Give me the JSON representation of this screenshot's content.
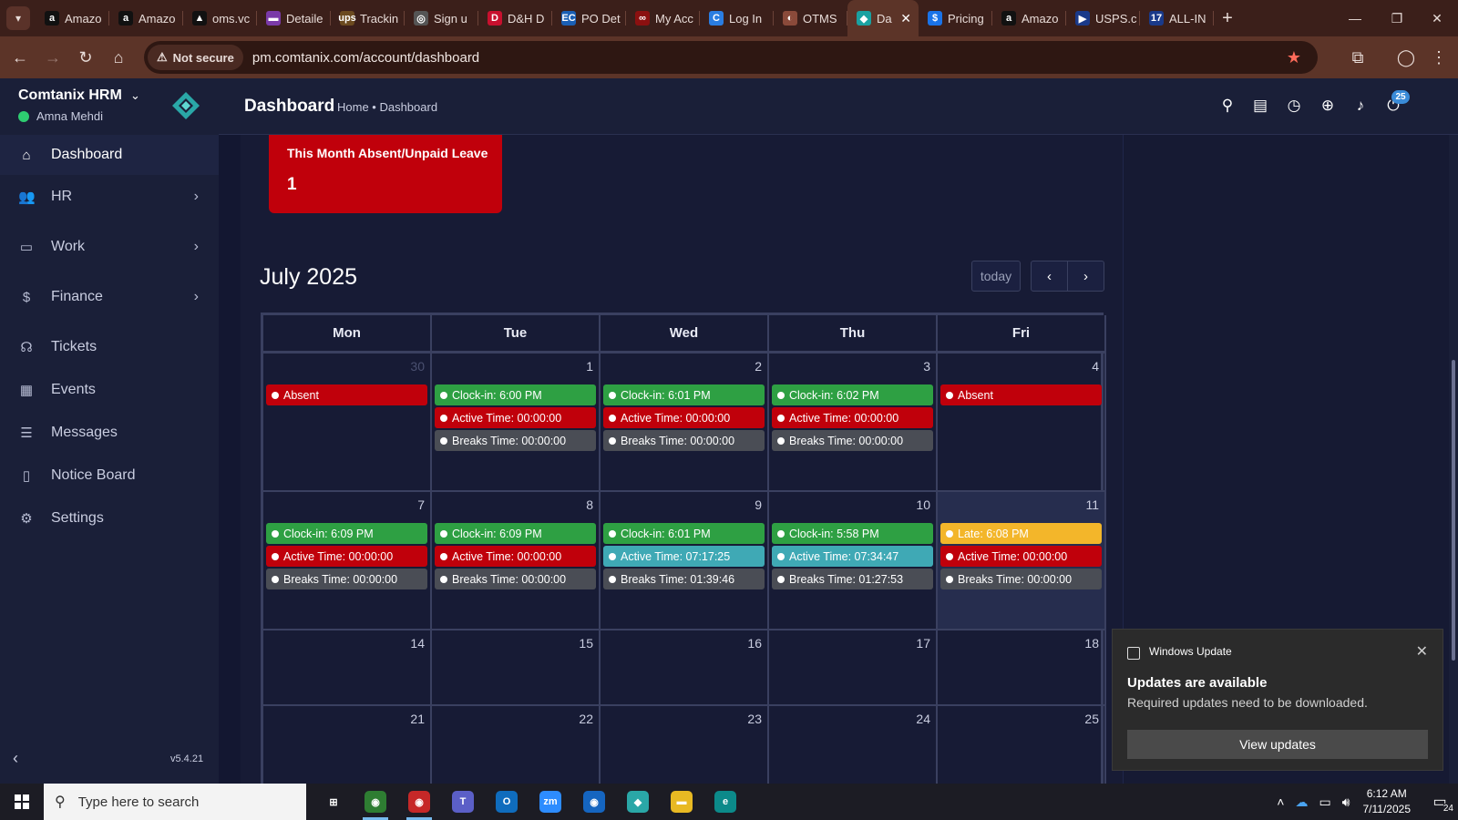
{
  "browser": {
    "tabs": [
      {
        "label": "Amazo",
        "fav": "a",
        "favColor": "#111111"
      },
      {
        "label": "Amazo",
        "fav": "a",
        "favColor": "#111111"
      },
      {
        "label": "oms.vc",
        "fav": "▲",
        "favColor": "#111111"
      },
      {
        "label": "Detaile",
        "fav": "▬",
        "favColor": "#7a3aa8"
      },
      {
        "label": "Trackin",
        "fav": "ups",
        "favColor": "#6b4a1f"
      },
      {
        "label": "Sign u",
        "fav": "◎",
        "favColor": "#555555"
      },
      {
        "label": "D&H D",
        "fav": "D",
        "favColor": "#c8102e"
      },
      {
        "label": "PO Det",
        "fav": "EC",
        "favColor": "#1a5fb4"
      },
      {
        "label": "My Acc",
        "fav": "∞",
        "favColor": "#8b1010"
      },
      {
        "label": "Log In",
        "fav": "C",
        "favColor": "#2a7de1"
      },
      {
        "label": "OTMS",
        "fav": "◐",
        "favColor": "#8a4a3a"
      },
      {
        "label": "Da",
        "fav": "◆",
        "favColor": "#1aa1a1",
        "active": true
      },
      {
        "label": "Pricing",
        "fav": "$",
        "favColor": "#1a73e8"
      },
      {
        "label": "Amazo",
        "fav": "a",
        "favColor": "#111111"
      },
      {
        "label": "USPS.c",
        "fav": "▶",
        "favColor": "#1a3a8a"
      },
      {
        "label": "ALL-IN",
        "fav": "17",
        "favColor": "#1a3a8a"
      }
    ],
    "new_tab": "+",
    "not_secure_label": "Not secure",
    "url": "pm.comtanix.com/account/dashboard"
  },
  "sidebar": {
    "brand": "Comtanix HRM",
    "user": "Amna Mehdi",
    "items": [
      {
        "label": "Dashboard",
        "icon": "home-icon",
        "glyph": "⌂",
        "active": true
      },
      {
        "label": "HR",
        "icon": "users-icon",
        "glyph": "👥",
        "arrow": true
      },
      {
        "label": "Work",
        "icon": "briefcase-icon",
        "glyph": "▭",
        "arrow": true
      },
      {
        "label": "Finance",
        "icon": "dollar-icon",
        "glyph": "$",
        "arrow": true
      },
      {
        "label": "Tickets",
        "icon": "headset-icon",
        "glyph": "☊"
      },
      {
        "label": "Events",
        "icon": "calendar-icon",
        "glyph": "▦"
      },
      {
        "label": "Messages",
        "icon": "message-icon",
        "glyph": "☰"
      },
      {
        "label": "Notice Board",
        "icon": "clipboard-icon",
        "glyph": "▯"
      },
      {
        "label": "Settings",
        "icon": "gear-icon",
        "glyph": "⚙"
      }
    ],
    "version": "v5.4.21"
  },
  "header": {
    "title": "Dashboard",
    "breadcrumb": "Home • Dashboard",
    "notifications_count": "25"
  },
  "absent_card": {
    "title": "This Month Absent/Unpaid Leave",
    "value": "1"
  },
  "calendar": {
    "title": "July 2025",
    "today_label": "today",
    "columns": [
      "Mon",
      "Tue",
      "Wed",
      "Thu",
      "Fri"
    ],
    "weeks": [
      [
        {
          "day": "30",
          "muted": true,
          "events": [
            {
              "text": "Absent",
              "color": "red"
            }
          ]
        },
        {
          "day": "1",
          "events": [
            {
              "text": "Clock-in: 6:00 PM",
              "color": "green"
            },
            {
              "text": "Active Time: 00:00:00",
              "color": "red"
            },
            {
              "text": "Breaks Time: 00:00:00",
              "color": "gray"
            }
          ]
        },
        {
          "day": "2",
          "events": [
            {
              "text": "Clock-in: 6:01 PM",
              "color": "green"
            },
            {
              "text": "Active Time: 00:00:00",
              "color": "red"
            },
            {
              "text": "Breaks Time: 00:00:00",
              "color": "gray"
            }
          ]
        },
        {
          "day": "3",
          "events": [
            {
              "text": "Clock-in: 6:02 PM",
              "color": "green"
            },
            {
              "text": "Active Time: 00:00:00",
              "color": "red"
            },
            {
              "text": "Breaks Time: 00:00:00",
              "color": "gray"
            }
          ]
        },
        {
          "day": "4",
          "events": [
            {
              "text": "Absent",
              "color": "red"
            }
          ]
        }
      ],
      [
        {
          "day": "7",
          "events": [
            {
              "text": "Clock-in: 6:09 PM",
              "color": "green"
            },
            {
              "text": "Active Time: 00:00:00",
              "color": "red"
            },
            {
              "text": "Breaks Time: 00:00:00",
              "color": "gray"
            }
          ]
        },
        {
          "day": "8",
          "events": [
            {
              "text": "Clock-in: 6:09 PM",
              "color": "green"
            },
            {
              "text": "Active Time: 00:00:00",
              "color": "red"
            },
            {
              "text": "Breaks Time: 00:00:00",
              "color": "gray"
            }
          ]
        },
        {
          "day": "9",
          "events": [
            {
              "text": "Clock-in: 6:01 PM",
              "color": "green"
            },
            {
              "text": "Active Time: 07:17:25",
              "color": "teal"
            },
            {
              "text": "Breaks Time: 01:39:46",
              "color": "gray"
            }
          ]
        },
        {
          "day": "10",
          "events": [
            {
              "text": "Clock-in: 5:58 PM",
              "color": "green"
            },
            {
              "text": "Active Time: 07:34:47",
              "color": "teal"
            },
            {
              "text": "Breaks Time: 01:27:53",
              "color": "gray"
            }
          ]
        },
        {
          "day": "11",
          "today": true,
          "events": [
            {
              "text": "Late: 6:08 PM",
              "color": "yellow"
            },
            {
              "text": "Active Time: 00:00:00",
              "color": "red"
            },
            {
              "text": "Breaks Time: 00:00:00",
              "color": "gray"
            }
          ]
        }
      ],
      [
        {
          "day": "14",
          "events": []
        },
        {
          "day": "15",
          "events": []
        },
        {
          "day": "16",
          "events": []
        },
        {
          "day": "17",
          "events": []
        },
        {
          "day": "18",
          "events": []
        }
      ],
      [
        {
          "day": "21",
          "events": []
        },
        {
          "day": "22",
          "events": []
        },
        {
          "day": "23",
          "events": []
        },
        {
          "day": "24",
          "events": []
        },
        {
          "day": "25",
          "events": []
        }
      ]
    ]
  },
  "toast": {
    "app": "Windows Update",
    "title": "Updates are available",
    "body": "Required updates need to be downloaded.",
    "button": "View updates"
  },
  "taskbar": {
    "search_placeholder": "Type here to search",
    "apps": [
      {
        "name": "task-view",
        "glyph": "⊞",
        "bg": "transparent"
      },
      {
        "name": "chrome",
        "glyph": "◉",
        "bg": "#2e7d32",
        "active": true
      },
      {
        "name": "chrome-profile",
        "glyph": "◉",
        "bg": "#c62828",
        "active": true
      },
      {
        "name": "teams",
        "glyph": "T",
        "bg": "#5b5fc7"
      },
      {
        "name": "outlook",
        "glyph": "O",
        "bg": "#0f6cbd"
      },
      {
        "name": "zoom",
        "glyph": "zm",
        "bg": "#2d8cff"
      },
      {
        "name": "chrome-2",
        "glyph": "◉",
        "bg": "#1565c0"
      },
      {
        "name": "comtanix",
        "glyph": "◆",
        "bg": "#2aa7a7"
      },
      {
        "name": "file-explorer",
        "glyph": "▬",
        "bg": "#e8b923"
      },
      {
        "name": "edge",
        "glyph": "e",
        "bg": "#0c8a8a"
      }
    ],
    "time": "6:12 AM",
    "date": "7/11/2025",
    "notifications": "24"
  },
  "colors": {
    "green": "#2ea043",
    "red": "#c0000b",
    "gray": "#4a4d55",
    "teal": "#3fa9b5",
    "yellow": "#f3b62a"
  }
}
